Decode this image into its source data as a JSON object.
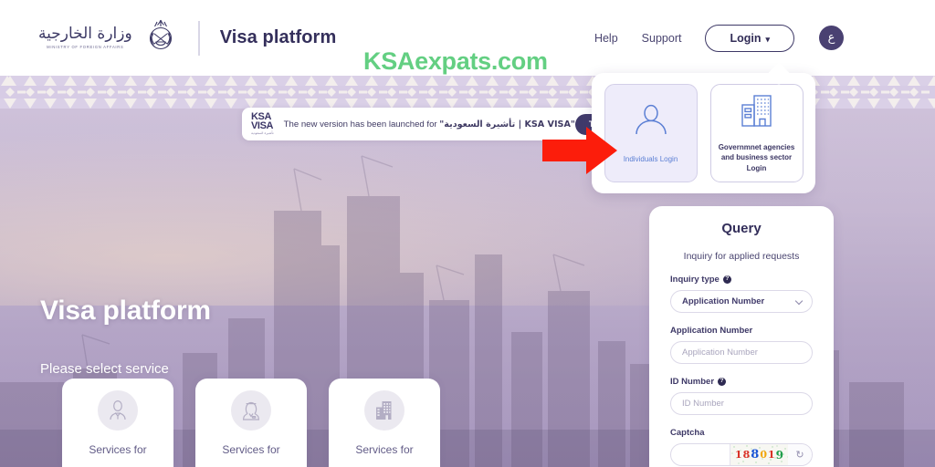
{
  "header": {
    "ministry_arabic": "وزارة الخارجية",
    "ministry_english": "MINISTRY OF FOREIGN AFFAIRS",
    "emblem_name": "saudi-emblem",
    "platform_title": "Visa platform",
    "nav": [
      {
        "label": "Help",
        "name": "help"
      },
      {
        "label": "Support",
        "name": "support"
      }
    ],
    "login_label": "Login",
    "login_caret": "▾",
    "language_toggle": "ع"
  },
  "watermark": {
    "text": "KSAexpats.com",
    "color": "#63cf82"
  },
  "login_panel": {
    "options": [
      {
        "label": "Individuals Login",
        "icon": "person-icon",
        "selected": true
      },
      {
        "label": "Governmnet agencies and business sector Login",
        "icon": "building-icon",
        "selected": false
      }
    ]
  },
  "annotation": {
    "arrow": "red-right-arrow",
    "color": "#fc1d0b",
    "points_to": "Individuals Login"
  },
  "version_banner": {
    "logo_line1": "KSA",
    "logo_line2": "VISA",
    "logo_arabic": "تأشيرة السعودية",
    "message_prefix": "The new version has been launched for ",
    "message_quoted": "\"تأشيرة السعودية | KSA VISA\"",
    "cta_label": "Try It"
  },
  "hero": {
    "title": "Visa platform",
    "subtitle": "Please select service",
    "background": "riyadh-skyline"
  },
  "service_cards": [
    {
      "label": "Services for",
      "icon": "businessman-icon"
    },
    {
      "label": "Services for",
      "icon": "saudi-citizen-icon"
    },
    {
      "label": "Services for",
      "icon": "company-building-icon"
    }
  ],
  "query_panel": {
    "title": "Query",
    "subtitle": "Inquiry for applied requests",
    "inquiry_type": {
      "label": "Inquiry type",
      "help": "?",
      "selected": "Application Number",
      "options": [
        "Application Number"
      ]
    },
    "application_number": {
      "label": "Application Number",
      "value": "",
      "placeholder": "Application Number"
    },
    "id_number": {
      "label": "ID Number",
      "help": "?",
      "value": "",
      "placeholder": "ID Number"
    },
    "captcha": {
      "label": "Captcha",
      "value": "",
      "refresh_icon": "↻",
      "digits": [
        {
          "char": "1",
          "color": "#d93025"
        },
        {
          "char": "8",
          "color": "#d93025"
        },
        {
          "char": "8",
          "color": "#1a56d6"
        },
        {
          "char": "0",
          "color": "#f2a60c"
        },
        {
          "char": "1",
          "color": "#d93025"
        },
        {
          "char": "9",
          "color": "#1e9e4a"
        }
      ]
    }
  }
}
